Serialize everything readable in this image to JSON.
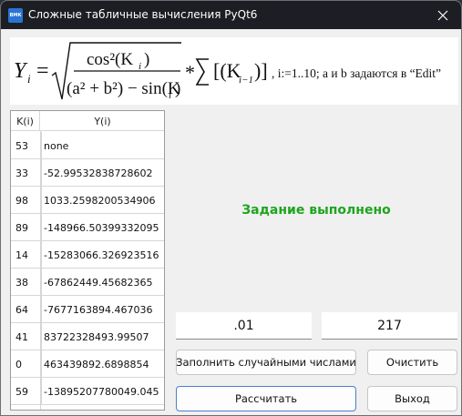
{
  "window": {
    "title": "Сложные табличные вычисления PyQt6",
    "app_icon_text": "ВМК"
  },
  "formula": {
    "lhs": "Y",
    "lhs_sub": "i",
    "eq": "=",
    "numerator": "cos²(K",
    "numerator_sub": "i",
    "numerator_close": ")",
    "denominator_left": "(a² + b²) − sin(K",
    "denominator_sub": "i",
    "denominator_close": ")",
    "times": "*",
    "sum_term": "[(K",
    "sum_sub": "i−1",
    "sum_close": ")]",
    "caption": ", i:=1..10; a и b задаются в “Edit”"
  },
  "table": {
    "headers": [
      "K(i)",
      "Y(i)"
    ],
    "rows": [
      {
        "k": "53",
        "y": "none"
      },
      {
        "k": "33",
        "y": "-52.99532838728602"
      },
      {
        "k": "98",
        "y": "1033.2598200534906"
      },
      {
        "k": "89",
        "y": "-148966.50399332095"
      },
      {
        "k": "14",
        "y": "-15283066.326923516"
      },
      {
        "k": "38",
        "y": "-67862449.45682365"
      },
      {
        "k": "64",
        "y": "-7677163894.467036"
      },
      {
        "k": "41",
        "y": "83722328493.99507"
      },
      {
        "k": "0",
        "y": "463439892.6898854"
      },
      {
        "k": "59",
        "y": "-13895207780049.045"
      }
    ]
  },
  "status": {
    "text": "Задание выполнено",
    "color": "#1ea51e"
  },
  "inputs": {
    "a_value": ".01",
    "b_value": "217"
  },
  "buttons": {
    "fill_random": "Заполнить случайными числами",
    "clear": "Очистить",
    "calculate": "Рассчитать",
    "exit": "Выход"
  },
  "icons": {
    "close": "close-icon",
    "app": "app-icon"
  }
}
